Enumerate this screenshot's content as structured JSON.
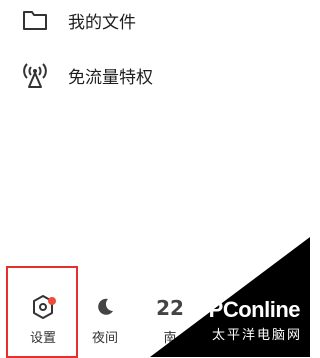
{
  "menu": {
    "items": [
      {
        "label": "我的文件",
        "icon": "folder-icon"
      },
      {
        "label": "免流量特权",
        "icon": "broadcast-icon"
      }
    ]
  },
  "bottom_bar": {
    "settings": {
      "label": "设置",
      "icon": "gear-icon",
      "badge": "red-dot"
    },
    "night": {
      "label": "夜间",
      "icon": "moon-icon"
    },
    "third": {
      "label": "南",
      "value": "22"
    }
  },
  "watermark": {
    "brand": "PConline",
    "subtitle": "太平洋电脑网"
  },
  "colors": {
    "highlight": "#e5302e",
    "badge": "#f04a3a"
  }
}
